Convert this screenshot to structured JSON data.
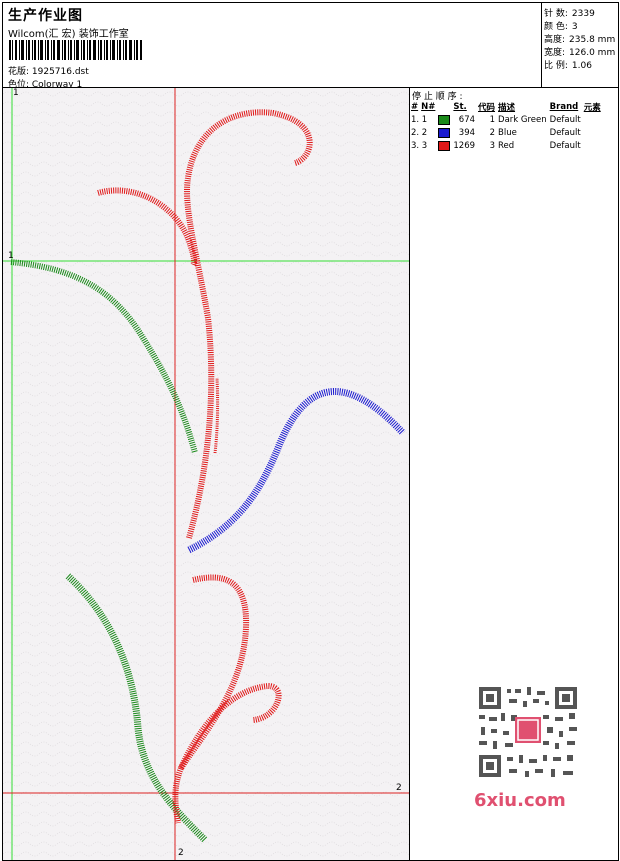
{
  "header": {
    "title": "生产作业图",
    "company": "Wilcom(汇 宏) 装饰工作室",
    "design_line": "花版:  1925716.dst",
    "colorway_line": "色位:  Colorway 1"
  },
  "stats": [
    {
      "label": "针 数:",
      "value": "2339"
    },
    {
      "label": "颜 色:",
      "value": "3"
    },
    {
      "label": "高度:",
      "value": "235.8 mm"
    },
    {
      "label": "宽度:",
      "value": "126.0 mm"
    },
    {
      "label": "比 例:",
      "value": "1.06"
    }
  ],
  "stop_sequence": {
    "title": "停 止 顺 序 :",
    "headers": [
      "#",
      "N#",
      "St.",
      "代码",
      "描述",
      "Brand",
      "元素"
    ],
    "rows": [
      {
        "idx": "1. 1",
        "color": "#1a8a1a",
        "stitches": "674",
        "code": "1",
        "desc": "Dark Green",
        "brand": "Default"
      },
      {
        "idx": "2. 2",
        "color": "#1a1ad0",
        "stitches": "394",
        "code": "2",
        "desc": "Blue",
        "brand": "Default"
      },
      {
        "idx": "3. 3",
        "color": "#e01818",
        "stitches": "1269",
        "code": "3",
        "desc": "Red",
        "brand": "Default"
      }
    ]
  },
  "axes": {
    "v_top": "1",
    "h_left": "1",
    "h_right": "2",
    "v_bottom": "2"
  },
  "watermark": "6xiu.com",
  "colors": {
    "thread_green": "#1a8a1a",
    "thread_blue": "#1a1ad0",
    "thread_red": "#e01818",
    "guide_green": "#33dd33",
    "guide_red": "#dd2222"
  }
}
